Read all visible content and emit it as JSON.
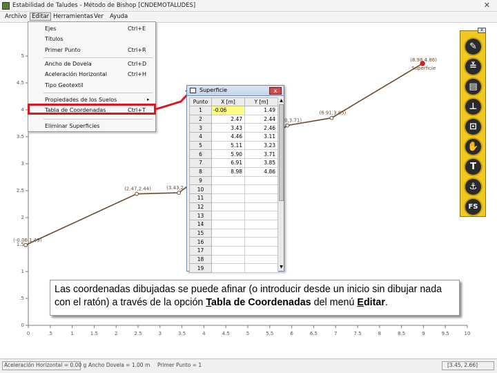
{
  "window": {
    "title": "Estabilidad de Taludes - Método de Bishop [CNDEMOTALUDES]",
    "close_glyph": "✕"
  },
  "menubar": {
    "items": [
      "Archivo",
      "Editar",
      "Herramientas",
      "Ver",
      "Ayuda"
    ]
  },
  "edit_menu": {
    "items": [
      {
        "label": "Ejes",
        "shortcut": "Ctrl+E"
      },
      {
        "label": "Títulos",
        "shortcut": ""
      },
      {
        "label": "Primer Punto",
        "shortcut": "Ctrl+R"
      },
      {
        "label": "Ancho de Dovela",
        "shortcut": "Ctrl+D"
      },
      {
        "label": "Aceleración Horizontal",
        "shortcut": "Ctrl+H"
      },
      {
        "label": "Tipo Geotextil",
        "shortcut": ""
      },
      {
        "label": "Propiedades de los Suelos",
        "shortcut": ""
      },
      {
        "label": "Tabla de Coordenadas",
        "shortcut": "Ctrl+T"
      },
      {
        "label": "Eliminar Superficies",
        "shortcut": ""
      }
    ],
    "highlight_color": "#e0141e"
  },
  "dialog": {
    "title": "Superficie",
    "close_glyph": "x",
    "columns": [
      "Punto",
      "X [m]",
      "Y [m]"
    ],
    "rows": [
      {
        "n": "1",
        "x": "-0.06",
        "y": "1.49"
      },
      {
        "n": "2",
        "x": "2.47",
        "y": "2.44"
      },
      {
        "n": "3",
        "x": "3.43",
        "y": "2.46"
      },
      {
        "n": "4",
        "x": "4.46",
        "y": "3.11"
      },
      {
        "n": "5",
        "x": "5.11",
        "y": "3.23"
      },
      {
        "n": "6",
        "x": "5.90",
        "y": "3.71"
      },
      {
        "n": "7",
        "x": "6.91",
        "y": "3.85"
      },
      {
        "n": "8",
        "x": "8.98",
        "y": "4.86"
      },
      {
        "n": "9",
        "x": "",
        "y": ""
      },
      {
        "n": "10",
        "x": "",
        "y": ""
      },
      {
        "n": "11",
        "x": "",
        "y": ""
      },
      {
        "n": "12",
        "x": "",
        "y": ""
      },
      {
        "n": "13",
        "x": "",
        "y": ""
      },
      {
        "n": "14",
        "x": "",
        "y": ""
      },
      {
        "n": "15",
        "x": "",
        "y": ""
      },
      {
        "n": "16",
        "x": "",
        "y": ""
      },
      {
        "n": "17",
        "x": "",
        "y": ""
      },
      {
        "n": "18",
        "x": "",
        "y": ""
      },
      {
        "n": "19",
        "x": "",
        "y": ""
      }
    ],
    "selected_cell_color": "#ffff80"
  },
  "plot": {
    "x_ticks": [
      "0",
      ".5",
      "1",
      "1.5",
      "2",
      "2.5",
      "3",
      "3.5",
      "4",
      "4.5",
      "5",
      "5.5",
      "6",
      "6.5",
      "7",
      "7.5",
      "8",
      "8.5",
      "9",
      "9.5",
      "10"
    ],
    "y_ticks": [
      "5",
      "4.5",
      "4",
      "3.5",
      "3",
      "2.5",
      "2",
      "1.5",
      "1",
      ".5",
      "0"
    ],
    "points": [
      {
        "label": "(-0.06,1.49)",
        "x": -0.06,
        "y": 1.49
      },
      {
        "label": "(2.47,2.44)",
        "x": 2.47,
        "y": 2.44
      },
      {
        "label": "(3.43,2.46)",
        "x": 3.43,
        "y": 2.46
      },
      {
        "label": "",
        "x": 4.46,
        "y": 3.11
      },
      {
        "label": "",
        "x": 5.11,
        "y": 3.23
      },
      {
        "label": "(5.90,3.71)",
        "x": 5.9,
        "y": 3.71
      },
      {
        "label": "(6.91,3.85)",
        "x": 6.91,
        "y": 3.85
      },
      {
        "label": "(8.98,4.86)",
        "x": 8.98,
        "y": 4.86
      }
    ],
    "surface_label": "Superficie",
    "line_color": "#6b4a2a",
    "last_point_color": "#e0141e"
  },
  "toolbox": {
    "close_glyph": "x",
    "tools": [
      {
        "name": "pencil-tool-icon",
        "glyph": "✎"
      },
      {
        "name": "layers-tool-icon",
        "glyph": "≚"
      },
      {
        "name": "grid-tool-icon",
        "glyph": "▤"
      },
      {
        "name": "level-tool-icon",
        "glyph": "⊥"
      },
      {
        "name": "frame-tool-icon",
        "glyph": "⊡"
      },
      {
        "name": "hand-tool-icon",
        "glyph": "✋"
      },
      {
        "name": "text-tool-icon",
        "glyph": "T"
      },
      {
        "name": "anchor-tool-icon",
        "glyph": "⚓"
      },
      {
        "name": "fs-tool-icon",
        "glyph": "FS"
      }
    ],
    "accent_color": "#f0c820"
  },
  "caption": {
    "text_before": "Las coordenadas dibujadas se puede afinar (o introducir desde un inicio sin dibujar nada con el ratón) a través de la opción ",
    "option_first": "T",
    "option_rest": "abla de Coordenadas",
    "text_middle": " del menú ",
    "menu_first": "E",
    "menu_rest": "ditar",
    "text_end": "."
  },
  "statusbar": {
    "accel": "Aceleración Horizontal = 0.00 g",
    "slice_width": "Ancho Dovela = 1.00 m",
    "first_point": "Primer Punto = 1",
    "coords": "[3.45, 2.66]"
  }
}
